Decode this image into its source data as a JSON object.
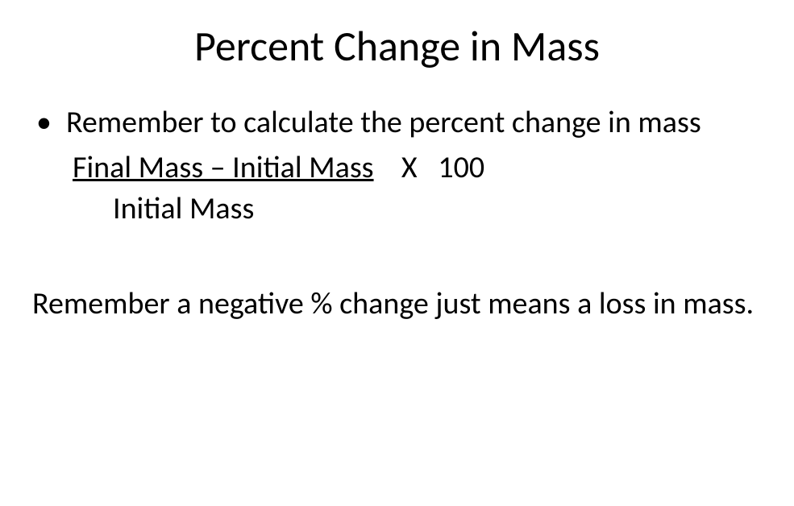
{
  "title": "Percent Change in Mass",
  "bullet": "•",
  "bulletText": "Remember to calculate the percent change in mass",
  "formulaNumerator": "Final Mass – Initial Mass",
  "formulaMultiplier": "    X   100",
  "formulaDenominator": "Initial Mass",
  "note": "Remember a negative % change just means a loss in mass."
}
